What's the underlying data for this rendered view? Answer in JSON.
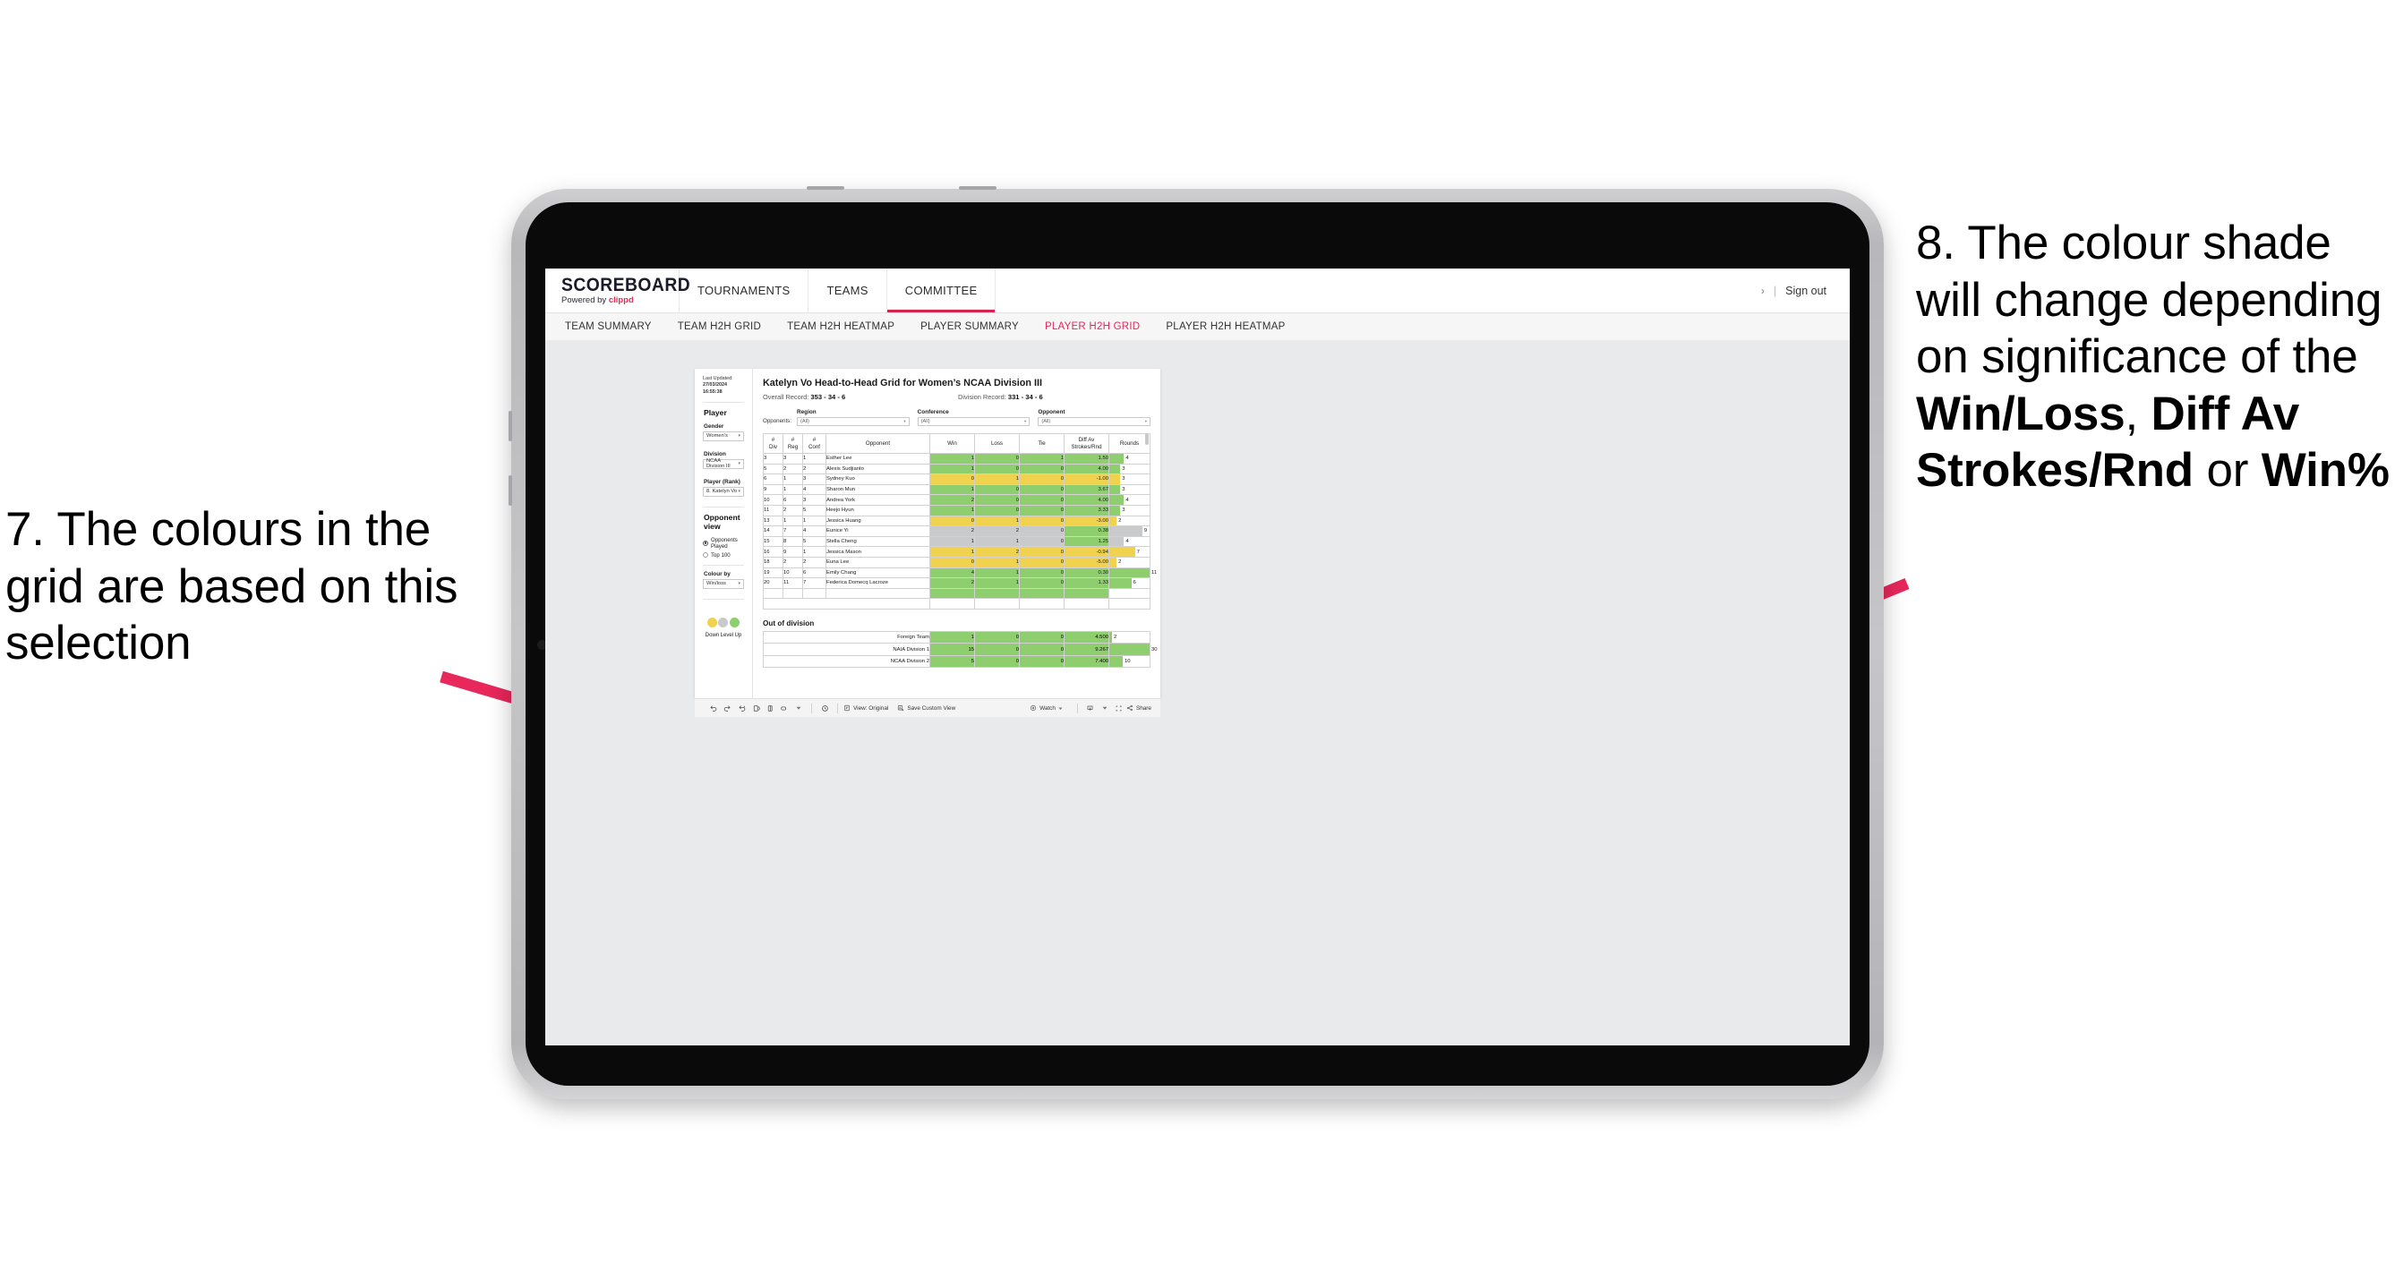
{
  "annotations": {
    "left": {
      "number": "7.",
      "text": "The colours in the grid are based on this selection",
      "full": "7. The colours in the grid are based on this selection"
    },
    "right": {
      "number": "8.",
      "lead": "8. The colour shade will change depending on significance of the ",
      "bold1": "Win/Loss",
      "mid1": ", ",
      "bold2": "Diff Av Strokes/Rnd",
      "mid2": " or ",
      "bold3": "Win%"
    },
    "arrow_color": "#e8275b"
  },
  "app": {
    "brand": {
      "title": "SCOREBOARD",
      "powered_prefix": "Powered by ",
      "powered_name": "clippd"
    },
    "topnav": [
      {
        "label": "TOURNAMENTS",
        "active": false
      },
      {
        "label": "TEAMS",
        "active": false
      },
      {
        "label": "COMMITTEE",
        "active": true
      }
    ],
    "topright": {
      "chevron": "›",
      "divider": "|",
      "signout": "Sign out"
    },
    "subnav": [
      {
        "label": "TEAM SUMMARY",
        "active": false
      },
      {
        "label": "TEAM H2H GRID",
        "active": false
      },
      {
        "label": "TEAM H2H HEATMAP",
        "active": false
      },
      {
        "label": "PLAYER SUMMARY",
        "active": false
      },
      {
        "label": "PLAYER H2H GRID",
        "active": true
      },
      {
        "label": "PLAYER H2H HEATMAP",
        "active": false
      }
    ],
    "accent_pink": "#e8275b",
    "accent_red": "#d6234f"
  },
  "filters": {
    "last_updated_label": "Last Updated:",
    "last_updated_value": "27/03/2024 16:55:38",
    "player_section": "Player",
    "gender": {
      "label": "Gender",
      "value": "Women’s"
    },
    "division": {
      "label": "Division",
      "value": "NCAA Division III"
    },
    "player_rank": {
      "label": "Player (Rank)",
      "value": "8. Katelyn Vo"
    },
    "opponent_view": {
      "title": "Opponent view",
      "options": [
        {
          "label": "Opponents Played",
          "selected": true
        },
        {
          "label": "Top 100",
          "selected": false
        }
      ]
    },
    "colour_by": {
      "label": "Colour by",
      "value": "Win/loss"
    },
    "legend": [
      {
        "label": "Down",
        "color": "#f0d24f"
      },
      {
        "label": "Level",
        "color": "#c8cacc"
      },
      {
        "label": "Up",
        "color": "#8ece6e"
      }
    ]
  },
  "viz": {
    "title": "Katelyn Vo Head-to-Head Grid for Women’s NCAA Division III",
    "overall_record_label": "Overall Record: ",
    "overall_record_value": "353 - 34 - 6",
    "division_record_label": "Division Record: ",
    "division_record_value": "331 - 34 - 6",
    "opponents_label": "Opponents:",
    "opponent_filters": [
      {
        "label": "Region",
        "value": "(All)"
      },
      {
        "label": "Conference",
        "value": "(All)"
      },
      {
        "label": "Opponent",
        "value": "(All)"
      }
    ],
    "columns": [
      "# Div",
      "# Reg",
      "# Conf",
      "Opponent",
      "Win",
      "Loss",
      "Tie",
      "Diff Av Strokes/Rnd",
      "Rounds"
    ],
    "column_lines": [
      [
        "#",
        "Div"
      ],
      [
        "#",
        "Reg"
      ],
      [
        "#",
        "Conf"
      ],
      [
        "Opponent",
        ""
      ],
      [
        "Win",
        ""
      ],
      [
        "Loss",
        ""
      ],
      [
        "Tie",
        ""
      ],
      [
        "Diff Av",
        "Strokes/Rnd"
      ],
      [
        "Rounds",
        ""
      ]
    ],
    "out_of_division_title": "Out of division"
  },
  "chart_data": {
    "type": "table",
    "title": "Katelyn Vo Head-to-Head Grid for Women’s NCAA Division III",
    "columns": [
      "# Div",
      "# Reg",
      "# Conf",
      "Opponent",
      "Win",
      "Loss",
      "Tie",
      "Diff Av Strokes/Rnd",
      "Rounds"
    ],
    "colour_scale": {
      "down": "#f0d24f",
      "level": "#c8cacc",
      "up": "#8ece6e"
    },
    "rounds_max": 11,
    "rows": [
      {
        "div": "3",
        "reg": "3",
        "conf": "1",
        "opponent": "Esther Lee",
        "win": "1",
        "loss": "0",
        "tie": "1",
        "diff": "1.50",
        "rounds": "4",
        "color": "up"
      },
      {
        "div": "5",
        "reg": "2",
        "conf": "2",
        "opponent": "Alexis Sudjianto",
        "win": "1",
        "loss": "0",
        "tie": "0",
        "diff": "4.00",
        "rounds": "3",
        "color": "up"
      },
      {
        "div": "6",
        "reg": "1",
        "conf": "3",
        "opponent": "Sydney Kuo",
        "win": "0",
        "loss": "1",
        "tie": "0",
        "diff": "-1.00",
        "rounds": "3",
        "color": "down"
      },
      {
        "div": "9",
        "reg": "1",
        "conf": "4",
        "opponent": "Sharon Mun",
        "win": "1",
        "loss": "0",
        "tie": "0",
        "diff": "3.67",
        "rounds": "3",
        "color": "up"
      },
      {
        "div": "10",
        "reg": "6",
        "conf": "3",
        "opponent": "Andrea York",
        "win": "2",
        "loss": "0",
        "tie": "0",
        "diff": "4.00",
        "rounds": "4",
        "color": "up"
      },
      {
        "div": "11",
        "reg": "2",
        "conf": "5",
        "opponent": "Heejo Hyun",
        "win": "1",
        "loss": "0",
        "tie": "0",
        "diff": "3.33",
        "rounds": "3",
        "color": "up"
      },
      {
        "div": "13",
        "reg": "1",
        "conf": "1",
        "opponent": "Jessica Huang",
        "win": "0",
        "loss": "1",
        "tie": "0",
        "diff": "-3.00",
        "rounds": "2",
        "color": "down"
      },
      {
        "div": "14",
        "reg": "7",
        "conf": "4",
        "opponent": "Eunice Yi",
        "win": "2",
        "loss": "2",
        "tie": "0",
        "diff": "0.38",
        "rounds": "9",
        "color": "level",
        "diff_color": "up"
      },
      {
        "div": "15",
        "reg": "8",
        "conf": "5",
        "opponent": "Stella Cheng",
        "win": "1",
        "loss": "1",
        "tie": "0",
        "diff": "1.25",
        "rounds": "4",
        "color": "level",
        "diff_color": "up"
      },
      {
        "div": "16",
        "reg": "9",
        "conf": "1",
        "opponent": "Jessica Mason",
        "win": "1",
        "loss": "2",
        "tie": "0",
        "diff": "-0.94",
        "rounds": "7",
        "color": "down"
      },
      {
        "div": "18",
        "reg": "2",
        "conf": "2",
        "opponent": "Euna Lee",
        "win": "0",
        "loss": "1",
        "tie": "0",
        "diff": "-5.00",
        "rounds": "2",
        "color": "down"
      },
      {
        "div": "19",
        "reg": "10",
        "conf": "6",
        "opponent": "Emily Chang",
        "win": "4",
        "loss": "1",
        "tie": "0",
        "diff": "0.30",
        "rounds": "11",
        "color": "up"
      },
      {
        "div": "20",
        "reg": "11",
        "conf": "7",
        "opponent": "Federica Domecq Lacroze",
        "win": "2",
        "loss": "1",
        "tie": "0",
        "diff": "1.33",
        "rounds": "6",
        "color": "up"
      }
    ],
    "out_of_division": {
      "title": "Out of division",
      "rows": [
        {
          "name": "Foreign Team",
          "win": "1",
          "loss": "0",
          "tie": "0",
          "diff": "4.500",
          "rounds": "2",
          "color": "up"
        },
        {
          "name": "NAIA Division 1",
          "win": "15",
          "loss": "0",
          "tie": "0",
          "diff": "9.267",
          "rounds": "30",
          "color": "up"
        },
        {
          "name": "NCAA Division 2",
          "win": "5",
          "loss": "0",
          "tie": "0",
          "diff": "7.400",
          "rounds": "10",
          "color": "up"
        }
      ],
      "rounds_max": 30
    }
  },
  "toolbar": {
    "view_label": "View: Original",
    "save_label": "Save Custom View",
    "watch_label": "Watch",
    "share_label": "Share"
  }
}
